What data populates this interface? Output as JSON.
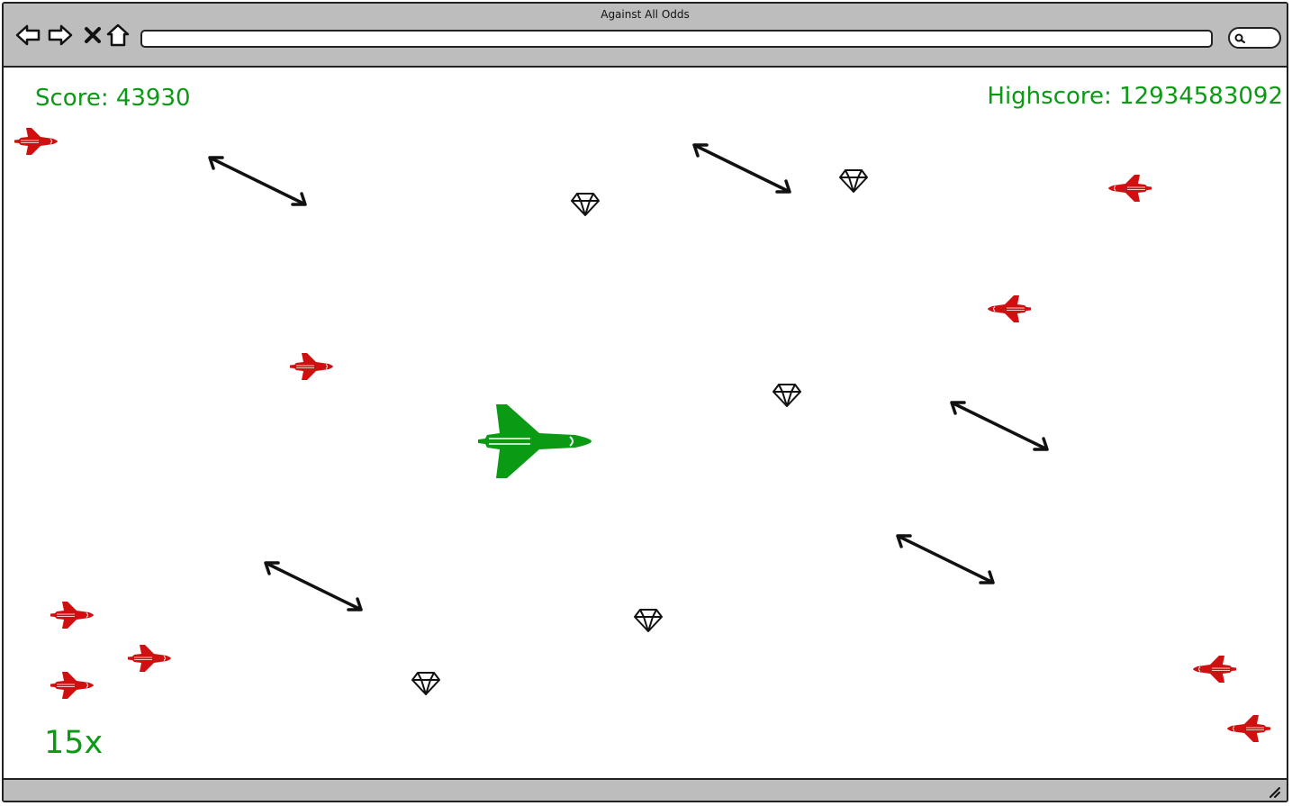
{
  "window": {
    "title": "Against All Odds"
  },
  "toolbar": {
    "back_icon": "back-arrow-icon",
    "forward_icon": "forward-arrow-icon",
    "close_icon": "close-icon",
    "home_icon": "home-icon",
    "url_value": "",
    "search_icon": "search-icon"
  },
  "hud": {
    "score": "Score: 43930",
    "highscore": "Highscore: 12934583092",
    "multiplier": "15x"
  },
  "colors": {
    "hud_text": "#0a9a14",
    "player": "#0a9a14",
    "enemy": "#d01010",
    "chrome": "#bdbdbd",
    "outline": "#222222"
  },
  "entities": {
    "player_icon": "space-shuttle-icon",
    "enemy_icon": "enemy-jet-icon",
    "pickup_icon": "diamond-icon",
    "obstacle_icon": "double-arrow-icon"
  }
}
